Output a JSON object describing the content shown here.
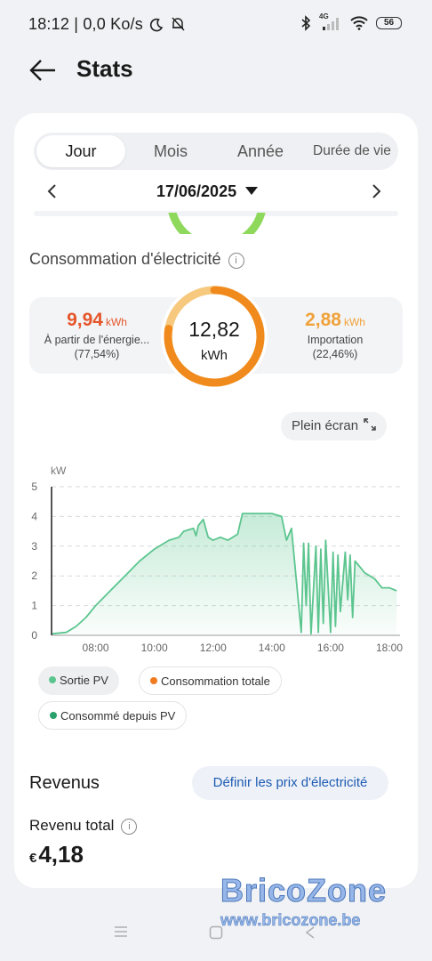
{
  "status_bar": {
    "time_info": "18:12 | 0,0 Ko/s",
    "network": "4G",
    "battery": "56"
  },
  "header": {
    "title": "Stats"
  },
  "tabs": [
    {
      "label": "Jour",
      "active": true
    },
    {
      "label": "Mois",
      "active": false
    },
    {
      "label": "Année",
      "active": false
    },
    {
      "label": "Durée de vie",
      "active": false
    }
  ],
  "date": "17/06/2025",
  "consumption": {
    "title": "Consommation d'électricité",
    "left_value": "9,94",
    "left_unit": "kWh",
    "left_label": "À partir de l'énergie...",
    "left_pct": "(77,54%)",
    "total_value": "12,82",
    "total_unit": "kWh",
    "right_value": "2,88",
    "right_unit": "kWh",
    "right_label": "Importation",
    "right_pct": "(22,46%)",
    "pv_share": 0.7754,
    "colors": {
      "pv": "#f08a1c",
      "import": "#f7c97e",
      "pv_text": "#e5562a",
      "import_text": "#f0a23a"
    }
  },
  "fullscreen_label": "Plein écran",
  "chart_data": {
    "type": "area",
    "ylabel": "kW",
    "ylim": [
      0,
      5
    ],
    "yticks": [
      "0",
      "1",
      "2",
      "3",
      "4",
      "5"
    ],
    "xticks": [
      "08:00",
      "10:00",
      "12:00",
      "14:00",
      "16:00",
      "18:00"
    ],
    "grid": true,
    "legend_placement": "bottom",
    "cursor_x": "06:30",
    "series": [
      {
        "name": "Sortie PV",
        "color": "#5cc58f",
        "x": [
          "06:00",
          "06:30",
          "07:00",
          "07:20",
          "07:40",
          "08:00",
          "08:30",
          "09:00",
          "09:30",
          "10:00",
          "10:30",
          "10:50",
          "11:00",
          "11:10",
          "11:20",
          "11:25",
          "11:30",
          "11:40",
          "11:50",
          "12:00",
          "12:15",
          "12:30",
          "12:50",
          "13:00",
          "14:00",
          "14:20",
          "14:30",
          "14:40",
          "15:00",
          "15:05",
          "15:10",
          "15:15",
          "15:20",
          "15:30",
          "15:35",
          "15:40",
          "15:45",
          "15:50",
          "16:00",
          "16:05",
          "16:10",
          "16:15",
          "16:20",
          "16:30",
          "16:35",
          "16:40",
          "16:45",
          "16:50",
          "17:00",
          "17:10",
          "17:20",
          "17:30",
          "17:45",
          "18:00",
          "18:15"
        ],
        "values": [
          0,
          0.05,
          0.1,
          0.3,
          0.6,
          1.0,
          1.5,
          2.0,
          2.5,
          2.9,
          3.2,
          3.3,
          3.5,
          3.55,
          3.6,
          3.35,
          3.7,
          3.9,
          3.3,
          3.2,
          3.3,
          3.2,
          3.4,
          4.1,
          4.1,
          4.0,
          3.2,
          3.6,
          0.1,
          3.1,
          1.0,
          3.1,
          0.05,
          3.0,
          0.1,
          2.9,
          0.4,
          3.2,
          0.1,
          2.8,
          0.3,
          2.7,
          0.8,
          2.8,
          1.2,
          2.7,
          0.6,
          2.5,
          2.3,
          2.1,
          2.0,
          1.9,
          1.6,
          1.6,
          1.5
        ]
      },
      {
        "name": "Consommation totale",
        "color": "#f07a1e"
      },
      {
        "name": "Consommé depuis PV",
        "color": "#2aa06a"
      }
    ]
  },
  "revenue": {
    "title": "Revenus",
    "set_price_label": "Définir les prix d'électricité",
    "total_label": "Revenu total",
    "currency": "€",
    "total_value": "4,18"
  },
  "watermark": {
    "line1": "BricoZone",
    "line2": "www.bricozone.be"
  }
}
